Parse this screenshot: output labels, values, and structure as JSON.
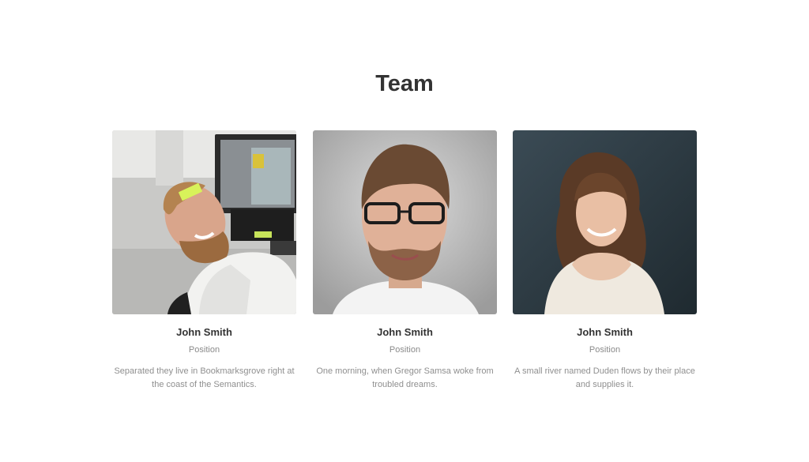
{
  "section": {
    "title": "Team"
  },
  "members": [
    {
      "name": "John Smith",
      "position": "Position",
      "bio": "Separated they live in Bookmarksgrove right at the coast of the Semantics.",
      "photo_alt": "John Smith"
    },
    {
      "name": "John Smith",
      "position": "Position",
      "bio": "One morning, when Gregor Samsa woke from troubled dreams.",
      "photo_alt": "John Smith"
    },
    {
      "name": "John Smith",
      "position": "Position",
      "bio": "A small river named Duden flows by their place and supplies it.",
      "photo_alt": "John Smith"
    }
  ]
}
